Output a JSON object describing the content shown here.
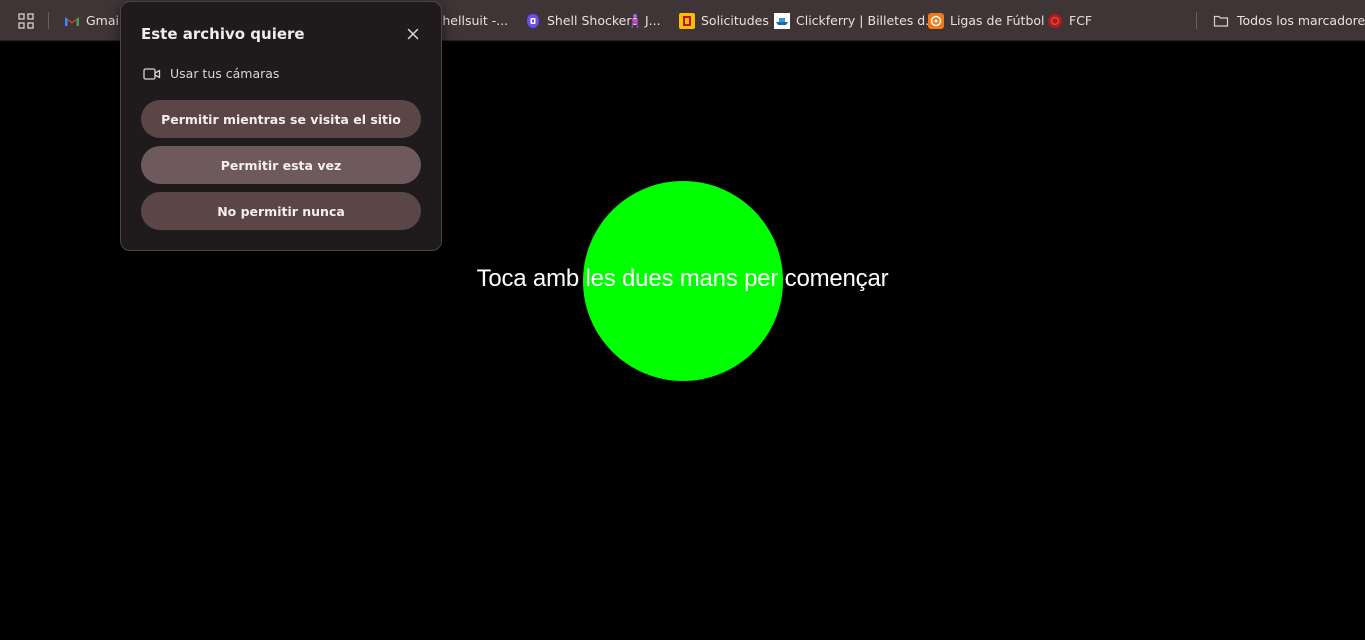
{
  "bookmarks": {
    "items": [
      {
        "label": "Gmail",
        "icon": "gmail-icon"
      },
      {
        "label": "t shellsuit -...",
        "icon": "none"
      },
      {
        "label": "Shell Shockers",
        "icon": "shell-shockers-icon"
      },
      {
        "label": "J...",
        "icon": "juggler-icon"
      },
      {
        "label": "Solicitudes",
        "icon": "spain-gov-icon"
      },
      {
        "label": "Clickferry | Billetes d...",
        "icon": "clickferry-icon"
      },
      {
        "label": "Ligas de Fútbol",
        "icon": "ligas-icon"
      },
      {
        "label": "FCF",
        "icon": "fcf-icon"
      }
    ],
    "all_bookmarks": "Todos los marcadores"
  },
  "dialog": {
    "title": "Este archivo quiere",
    "permission": "Usar tus cámaras",
    "buttons": {
      "allow_while_visiting": "Permitir mientras se visita el sitio",
      "allow_once": "Permitir esta vez",
      "never_allow": "No permitir nunca"
    }
  },
  "stage": {
    "prompt": "Toca amb les dues mans per començar",
    "circle_color": "#00ff00"
  },
  "colors": {
    "toolbar_bg": "#3f3537",
    "dialog_bg": "#1f1b1c",
    "button_bg": "#5a4547",
    "button_hover_bg": "#6e5a5c"
  }
}
